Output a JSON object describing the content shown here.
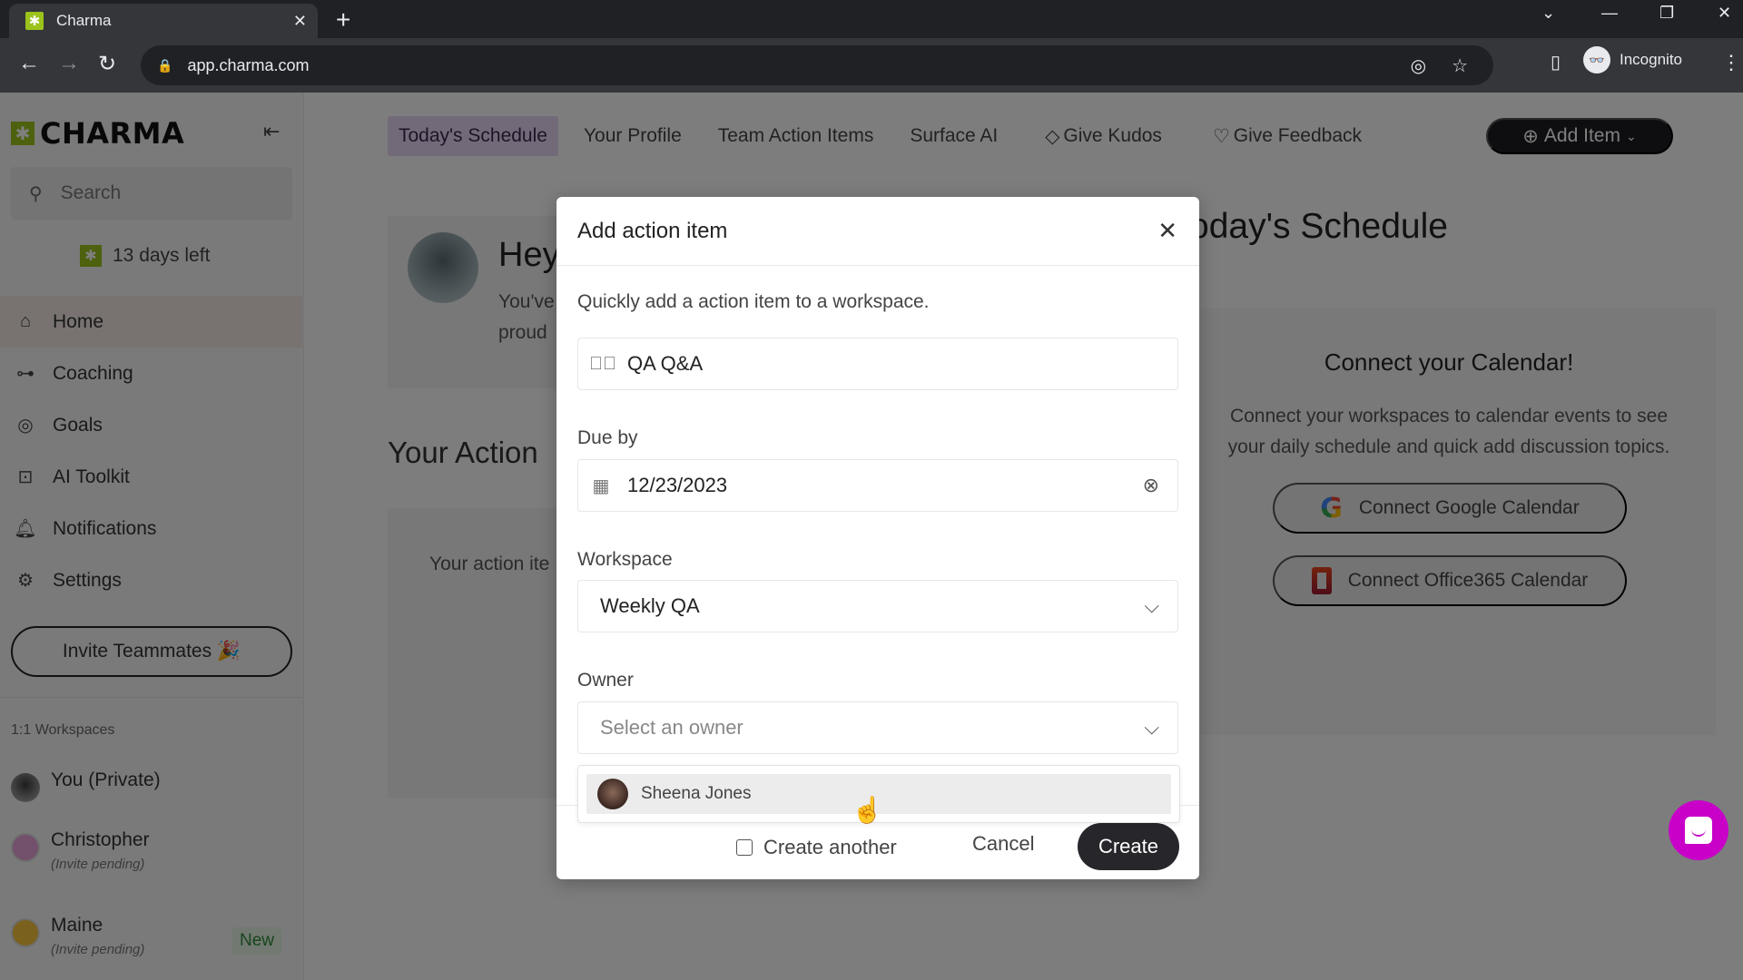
{
  "browser": {
    "tab_title": "Charma",
    "url": "app.charma.com",
    "profile_label": "Incognito"
  },
  "sidebar": {
    "brand": "CHARMA",
    "search_placeholder": "Search",
    "trial": "13 days left",
    "nav": [
      {
        "label": "Home",
        "icon": "home-heart-icon",
        "active": true
      },
      {
        "label": "Coaching",
        "icon": "whistle-icon",
        "active": false
      },
      {
        "label": "Goals",
        "icon": "target-icon",
        "active": false
      },
      {
        "label": "AI Toolkit",
        "icon": "robot-icon",
        "active": false
      },
      {
        "label": "Notifications",
        "icon": "bell-icon",
        "active": false
      },
      {
        "label": "Settings",
        "icon": "gear-icon",
        "active": false
      }
    ],
    "invite_label": "Invite Teammates 🎉",
    "workspaces_header": "1:1 Workspaces",
    "workspaces": [
      {
        "name": "You (Private)",
        "sub": ""
      },
      {
        "name": "Christopher",
        "sub": "(Invite pending)"
      },
      {
        "name": "Maine",
        "sub": "(Invite pending)",
        "badge": "New"
      }
    ]
  },
  "topnav": {
    "tabs": [
      {
        "label": "Today's Schedule",
        "active": true
      },
      {
        "label": "Your Profile",
        "active": false
      },
      {
        "label": "Team Action Items",
        "active": false
      },
      {
        "label": "Surface AI",
        "active": false
      },
      {
        "label": "Give Kudos",
        "active": false
      },
      {
        "label": "Give Feedback",
        "active": false
      }
    ],
    "add_item_label": "Add Item"
  },
  "main": {
    "greeting": "Hey",
    "greeting_sub_1": "You've",
    "greeting_sub_2": "proud",
    "action_title": "Your Action",
    "action_empty": "Your action ite",
    "schedule_title": "oday's Schedule",
    "calendar": {
      "heading": "Connect your Calendar!",
      "body": "Connect your workspaces to calendar events to see your daily schedule and quick add discussion topics.",
      "google_label": "Connect Google Calendar",
      "office_label": "Connect Office365 Calendar"
    }
  },
  "modal": {
    "title": "Add action item",
    "description": "Quickly add a action item to a workspace.",
    "item_value": "QA Q&A",
    "due_label": "Due by",
    "due_value": "12/23/2023",
    "workspace_label": "Workspace",
    "workspace_value": "Weekly QA",
    "owner_label": "Owner",
    "owner_placeholder": "Select an owner",
    "owner_options": [
      {
        "name": "Sheena Jones"
      }
    ],
    "create_another_label": "Create another",
    "create_another_checked": false,
    "cancel_label": "Cancel",
    "create_label": "Create"
  },
  "colors": {
    "brand_green": "#9bc31c",
    "active_tab": "#e6d5f3",
    "primary_button": "#26262b",
    "chat_launcher": "#c800c8"
  }
}
